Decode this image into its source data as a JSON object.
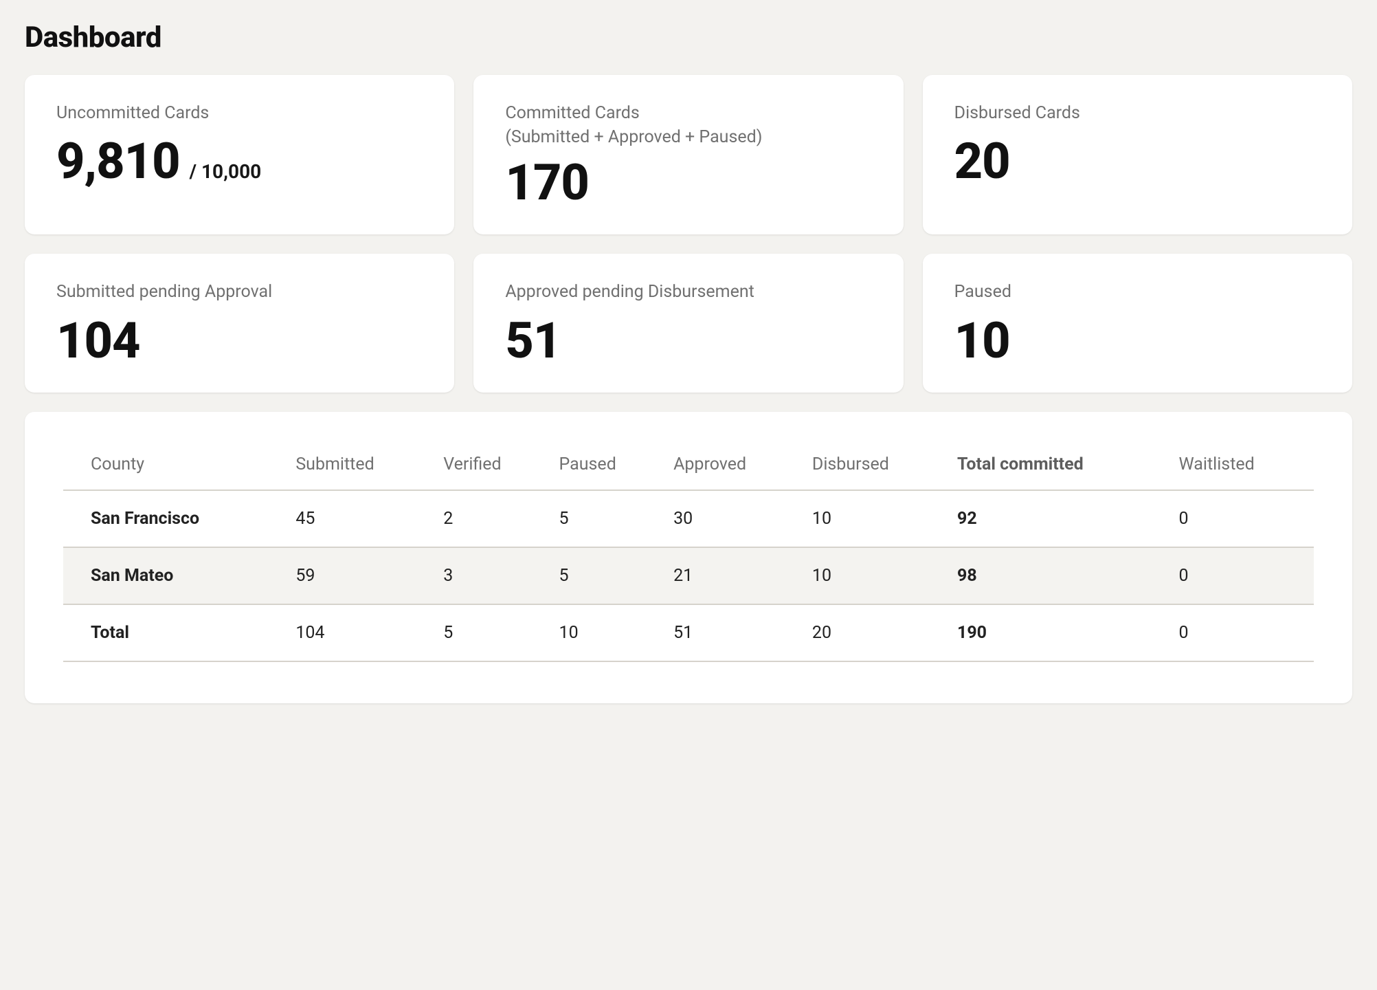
{
  "title": "Dashboard",
  "cards": [
    {
      "label": "Uncommitted Cards",
      "sublabel": "",
      "value": "9,810",
      "suffix": "/ 10,000"
    },
    {
      "label": "Committed Cards",
      "sublabel": "(Submitted + Approved + Paused)",
      "value": "170",
      "suffix": ""
    },
    {
      "label": "Disbursed Cards",
      "sublabel": "",
      "value": "20",
      "suffix": ""
    },
    {
      "label": "Submitted pending Approval",
      "sublabel": "",
      "value": "104",
      "suffix": ""
    },
    {
      "label": "Approved pending Disbursement",
      "sublabel": "",
      "value": "51",
      "suffix": ""
    },
    {
      "label": "Paused",
      "sublabel": "",
      "value": "10",
      "suffix": ""
    }
  ],
  "table": {
    "headers": [
      "County",
      "Submitted",
      "Verified",
      "Paused",
      "Approved",
      "Disbursed",
      "Total committed",
      "Waitlisted"
    ],
    "bold_header_index": 6,
    "rows": [
      {
        "cells": [
          "San Francisco",
          "45",
          "2",
          "5",
          "30",
          "10",
          "92",
          "0"
        ],
        "alt": false
      },
      {
        "cells": [
          "San Mateo",
          "59",
          "3",
          "5",
          "21",
          "10",
          "98",
          "0"
        ],
        "alt": true
      },
      {
        "cells": [
          "Total",
          "104",
          "5",
          "10",
          "51",
          "20",
          "190",
          "0"
        ],
        "alt": false
      }
    ],
    "bold_col_index": 6
  },
  "chart_data": {
    "type": "table",
    "title": "Dashboard",
    "summary_cards": [
      {
        "metric": "Uncommitted Cards",
        "value": 9810,
        "denominator": 10000
      },
      {
        "metric": "Committed Cards (Submitted + Approved + Paused)",
        "value": 170
      },
      {
        "metric": "Disbursed Cards",
        "value": 20
      },
      {
        "metric": "Submitted pending Approval",
        "value": 104
      },
      {
        "metric": "Approved pending Disbursement",
        "value": 51
      },
      {
        "metric": "Paused",
        "value": 10
      }
    ],
    "columns": [
      "County",
      "Submitted",
      "Verified",
      "Paused",
      "Approved",
      "Disbursed",
      "Total committed",
      "Waitlisted"
    ],
    "rows": [
      [
        "San Francisco",
        45,
        2,
        5,
        30,
        10,
        92,
        0
      ],
      [
        "San Mateo",
        59,
        3,
        5,
        21,
        10,
        98,
        0
      ],
      [
        "Total",
        104,
        5,
        10,
        51,
        20,
        190,
        0
      ]
    ]
  }
}
